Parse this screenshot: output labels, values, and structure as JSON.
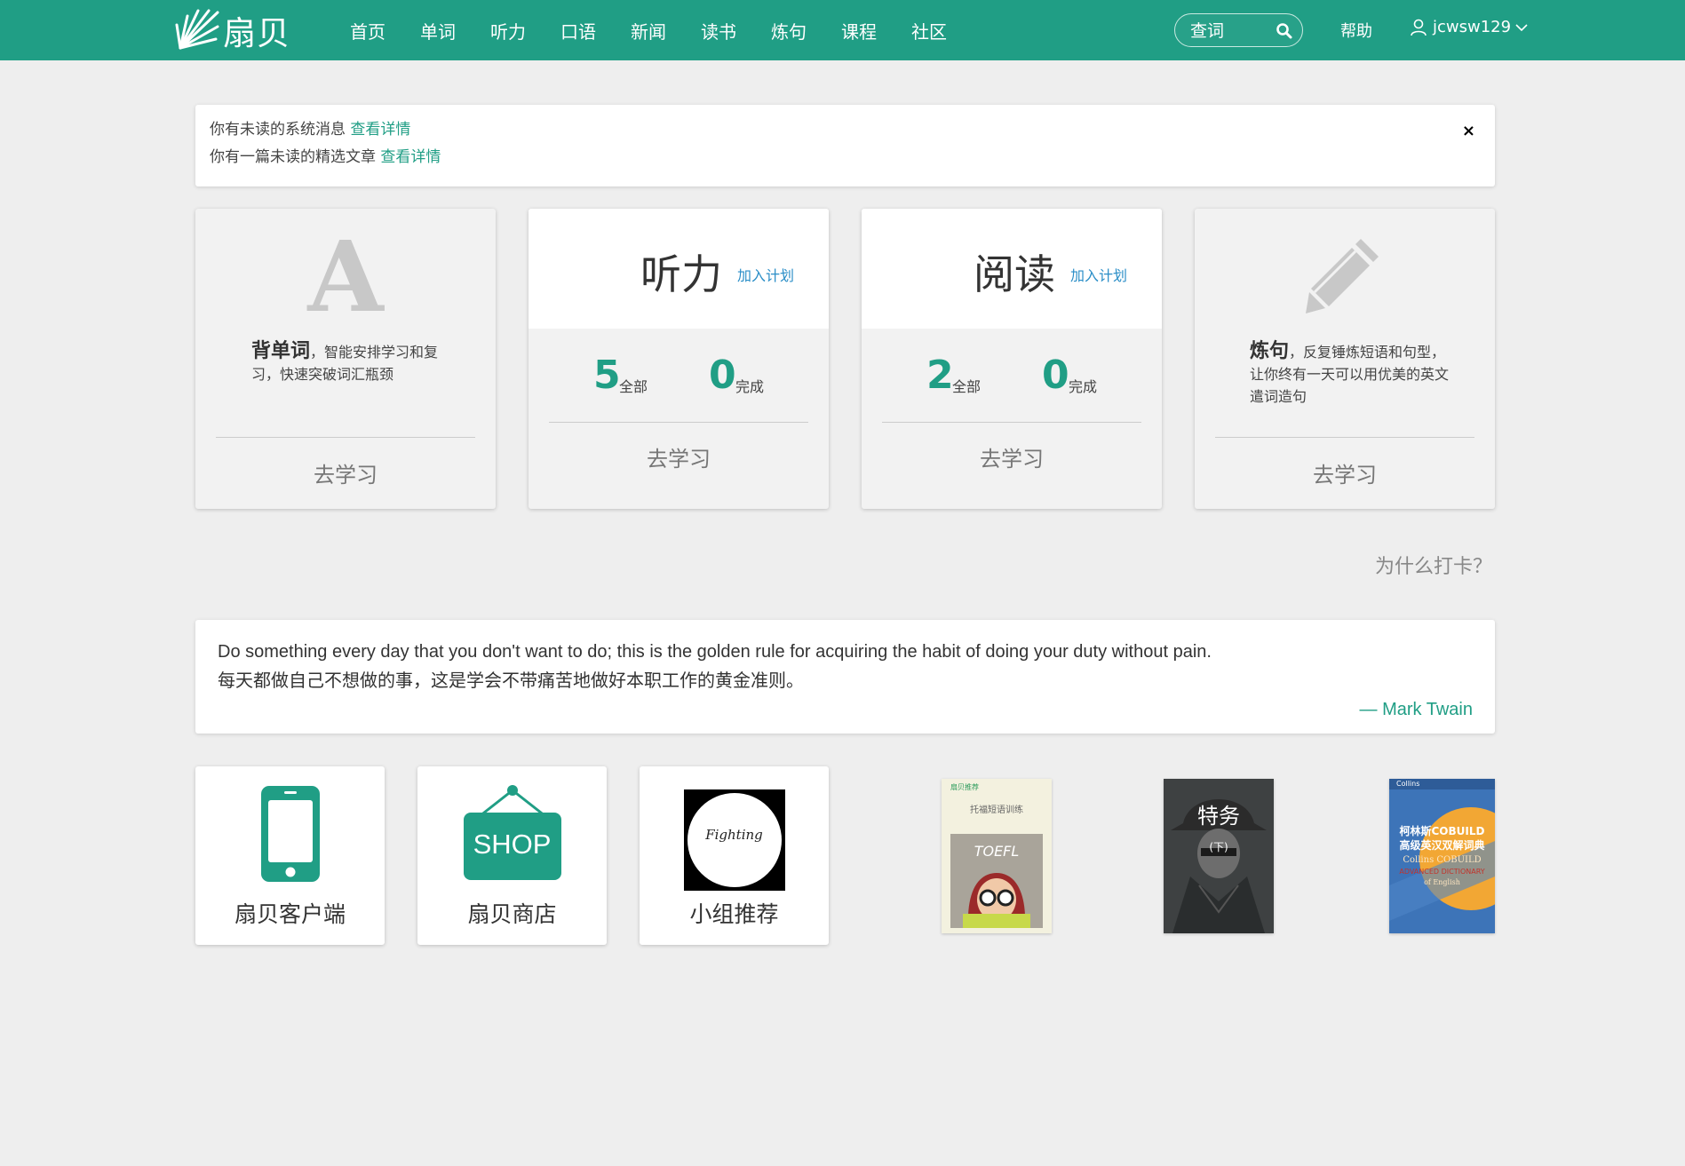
{
  "header": {
    "logo_text": "扇贝",
    "nav": [
      "首页",
      "单词",
      "听力",
      "口语",
      "新闻",
      "读书",
      "炼句",
      "课程",
      "社区"
    ],
    "search_placeholder": "查词",
    "help": "帮助",
    "username": "jcwsw129"
  },
  "notice": {
    "line1_text": "你有未读的系统消息",
    "line1_link": "查看详情",
    "line2_text": "你有一篇未读的精选文章",
    "line2_link": "查看详情",
    "close": "×"
  },
  "cards": {
    "vocab": {
      "glyph": "A",
      "title": "背单词",
      "desc": "，智能安排学习和复习，快速突破词汇瓶颈",
      "button": "去学习"
    },
    "listening": {
      "title": "听力",
      "plan_link": "加入计划",
      "total_num": "5",
      "total_label": "全部",
      "done_num": "0",
      "done_label": "完成",
      "button": "去学习"
    },
    "reading": {
      "title": "阅读",
      "plan_link": "加入计划",
      "total_num": "2",
      "total_label": "全部",
      "done_num": "0",
      "done_label": "完成",
      "button": "去学习"
    },
    "sentence": {
      "title": "炼句",
      "desc": "，反复锤炼短语和句型，让你终有一天可以用优美的英文遣词造句",
      "button": "去学习"
    }
  },
  "why_checkin": "为什么打卡？",
  "quote": {
    "en": "Do something every day that you don't want to do; this is the golden rule for acquiring the habit of doing your duty without pain.",
    "zh": "每天都做自己不想做的事，这是学会不带痛苦地做好本职工作的黄金准则。",
    "author": "— Mark Twain"
  },
  "tiles": {
    "client": "扇贝客户端",
    "shop_label": "扇贝商店",
    "shop_sign": "SHOP",
    "group": "小组推荐",
    "group_logo_text": "Fighting"
  },
  "books": {
    "toefl_header": "扇贝推荐",
    "toefl_title": "托福短语训练",
    "toefl_cover_word": "TOEFL",
    "agent_title": "特务",
    "agent_sub": "(下)",
    "collins_brand": "Collins",
    "collins_title_zh_1": "柯林斯COBUILD",
    "collins_title_zh_2": "高级英汉双解词典",
    "collins_title_en_1": "Collins COBUILD",
    "collins_title_en_2": "ADVANCED DICTIONARY",
    "collins_title_en_3": "of English"
  },
  "colors": {
    "brand": "#209e85",
    "link": "#2a8ec7",
    "background": "#eeeeee"
  }
}
